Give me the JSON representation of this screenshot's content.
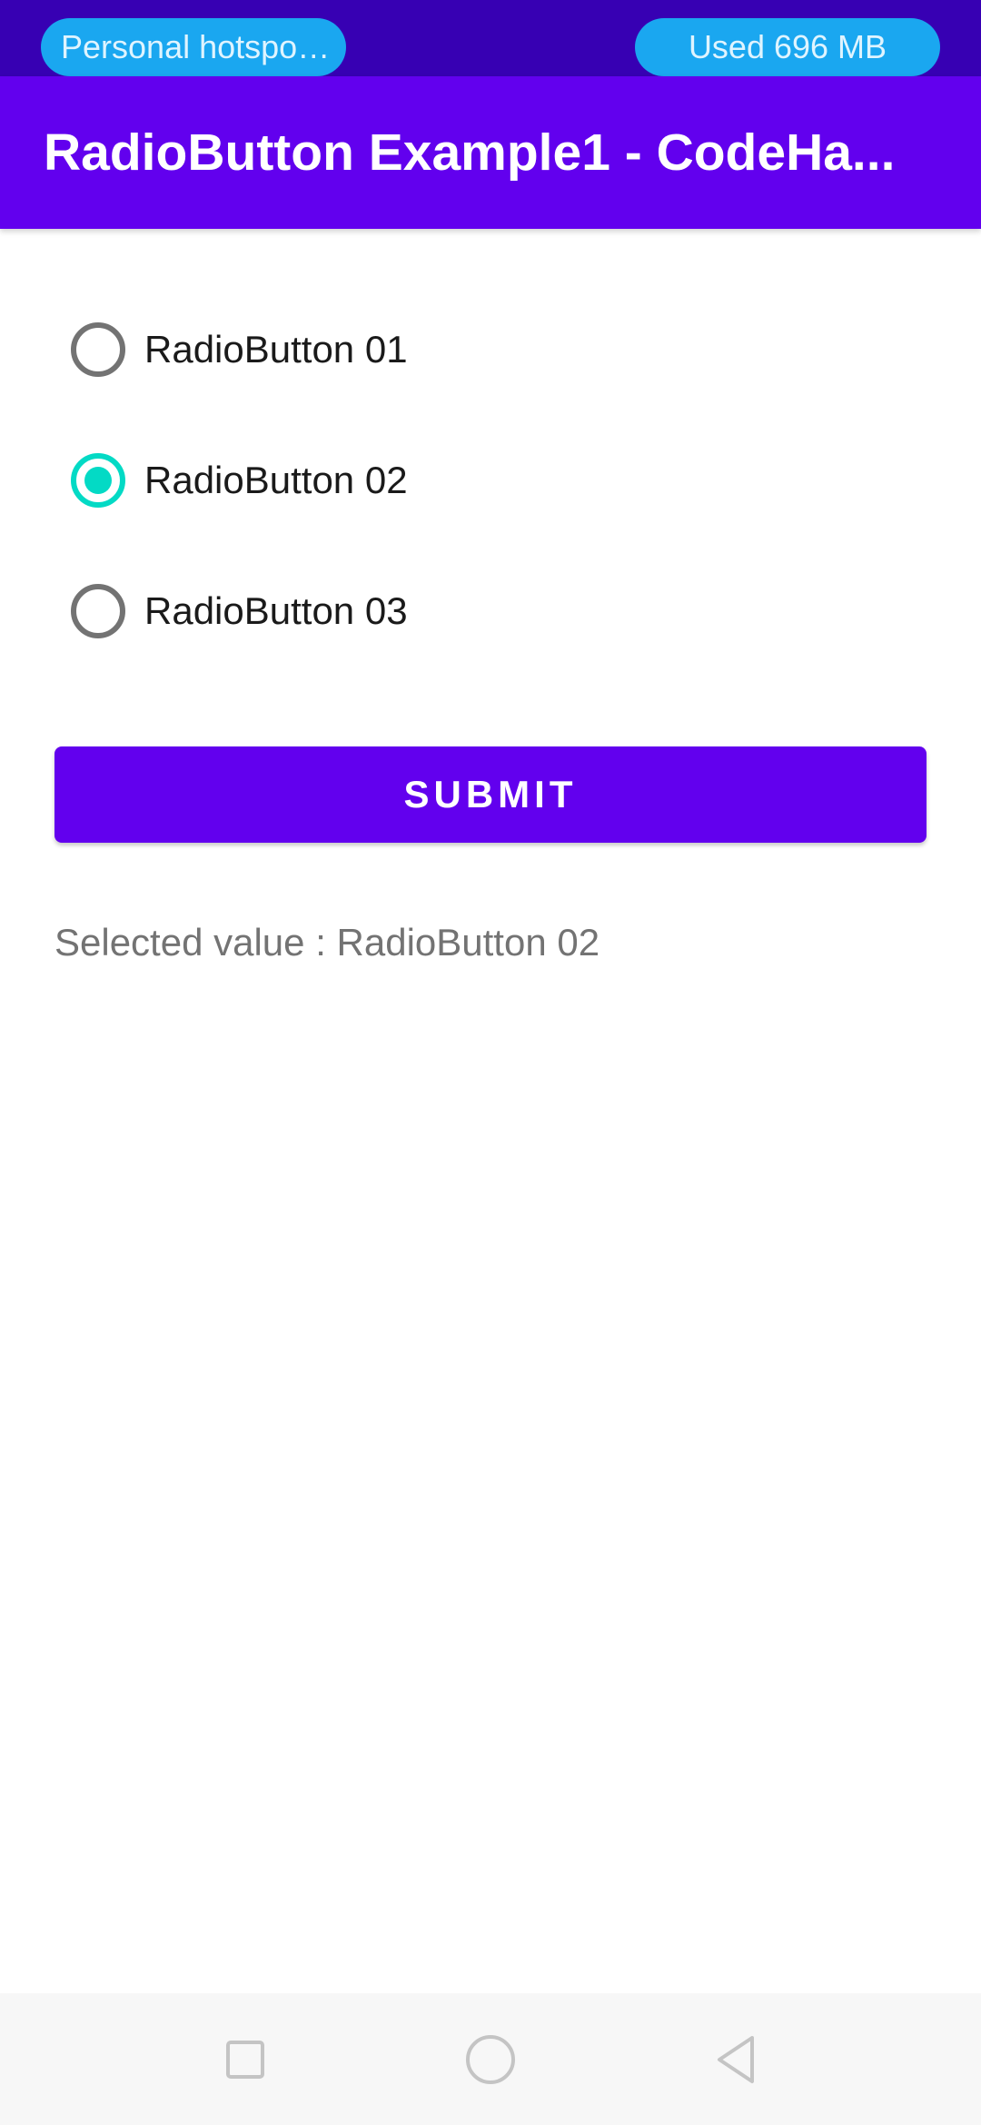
{
  "status_bar": {
    "hotspot_label": "Personal hotspot ...",
    "data_usage": "Used  696 MB"
  },
  "app_bar": {
    "title": "RadioButton Example1 - CodeHa..."
  },
  "radio_group": {
    "options": [
      {
        "label": "RadioButton 01",
        "checked": false
      },
      {
        "label": "RadioButton 02",
        "checked": true
      },
      {
        "label": "RadioButton 03",
        "checked": false
      }
    ]
  },
  "submit_label": "SUBMIT",
  "selected_text": "Selected value : RadioButton 02",
  "nav_bar": {
    "icons": [
      "recents-square-icon",
      "home-circle-icon",
      "back-triangle-icon"
    ]
  },
  "colors": {
    "status_bar": "#3700b3",
    "primary": "#6200ee",
    "accent": "#03dac5",
    "pill": "#1aa7f0"
  }
}
